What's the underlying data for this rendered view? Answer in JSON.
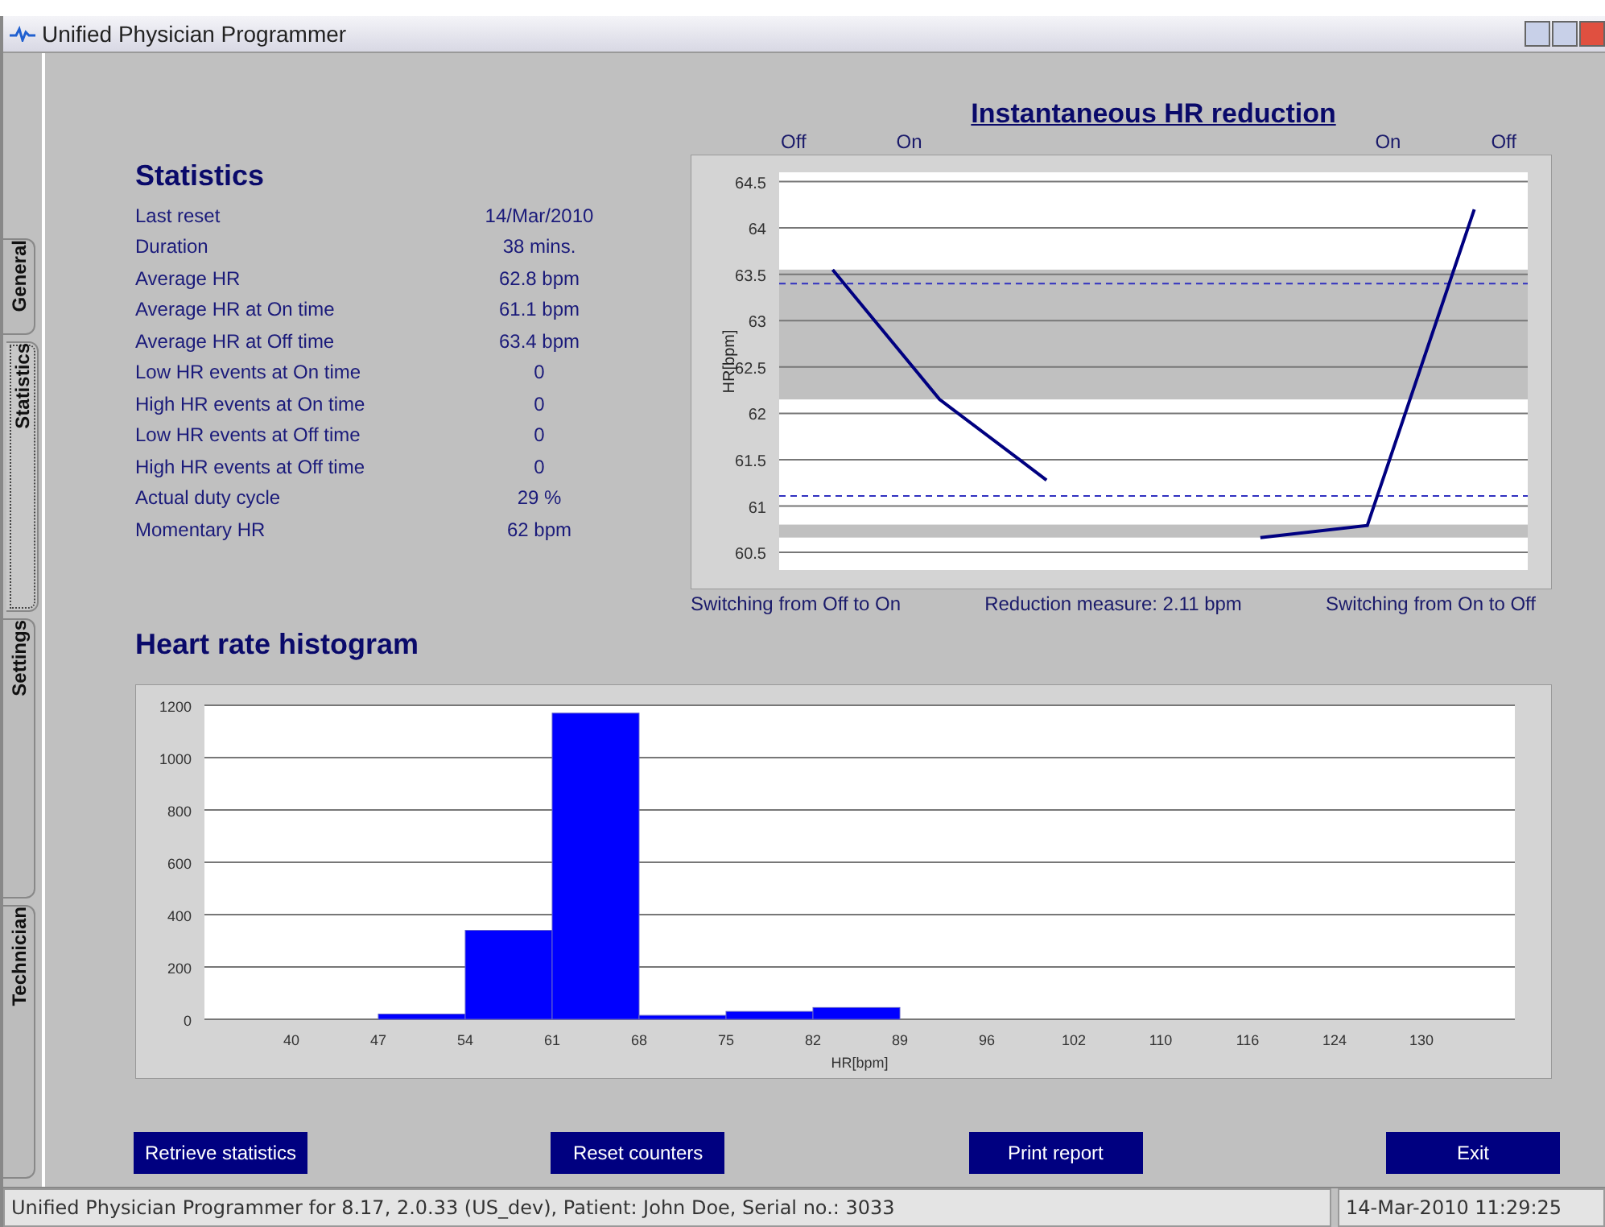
{
  "window": {
    "title": "Unified Physician Programmer"
  },
  "tabs": [
    {
      "label": "General",
      "selected": false
    },
    {
      "label": "Statistics",
      "selected": true
    },
    {
      "label": "Settings",
      "selected": false
    },
    {
      "label": "Technician",
      "selected": false
    }
  ],
  "statistics": {
    "title": "Statistics",
    "rows": [
      {
        "label": "Last reset",
        "value": "14/Mar/2010"
      },
      {
        "label": "Duration",
        "value": "38 mins."
      },
      {
        "label": "Average HR",
        "value": "62.8 bpm"
      },
      {
        "label": "Average HR at On time",
        "value": "61.1 bpm"
      },
      {
        "label": "Average HR at Off time",
        "value": "63.4 bpm"
      },
      {
        "label": "Low HR events at On time",
        "value": "0"
      },
      {
        "label": "High HR events at On time",
        "value": "0"
      },
      {
        "label": "Low HR events at Off time",
        "value": "0"
      },
      {
        "label": "High HR events at Off time",
        "value": "0"
      },
      {
        "label": "Actual duty cycle",
        "value": "29 %"
      },
      {
        "label": "Momentary HR",
        "value": "62 bpm"
      }
    ]
  },
  "reduction_chart": {
    "top_labels": [
      "Off",
      "On",
      "On",
      "Off"
    ],
    "measure": "Reduction measure: 2.11 bpm",
    "chart_data": {
      "type": "line",
      "title": "Instantaneous HR reduction",
      "ylabel": "HR[bpm]",
      "grid": true,
      "ylim": [
        60.31,
        64.6
      ],
      "yticks": [
        60.5,
        61,
        61.5,
        62,
        62.5,
        63,
        63.5,
        64,
        64.5
      ],
      "series": [
        {
          "name": "Switching from Off to On",
          "color": "#000080",
          "values": [
            63.55,
            62.15,
            61.28,
            null,
            null,
            null,
            null
          ]
        },
        {
          "name": "Switching from On to Off",
          "color": "#000080",
          "values": [
            null,
            null,
            null,
            null,
            60.66,
            60.79,
            64.2
          ]
        }
      ],
      "bands": [
        {
          "axis": "y",
          "from": 62.15,
          "to": 63.55
        },
        {
          "axis": "y",
          "from": 60.66,
          "to": 60.8
        }
      ],
      "ref_lines": [
        {
          "axis": "y",
          "value": 63.4
        },
        {
          "axis": "y",
          "value": 61.11
        }
      ]
    }
  },
  "histogram": {
    "chart_data": {
      "type": "bar",
      "title": "Heart rate histogram",
      "xlabel": "HR[bpm]",
      "grid": true,
      "categories": [
        "40",
        "47",
        "54",
        "61",
        "68",
        "75",
        "82",
        "89",
        "96",
        "102",
        "110",
        "116",
        "124",
        "130"
      ],
      "ylim": [
        0,
        1200
      ],
      "yticks": [
        0,
        200,
        400,
        600,
        800,
        1000,
        1200
      ],
      "series": [
        {
          "color": "#0000ff",
          "values": [
            0,
            20,
            340,
            1170,
            15,
            30,
            45,
            0,
            0,
            0,
            0,
            0,
            0,
            0
          ]
        }
      ]
    }
  },
  "buttons": [
    "Retrieve statistics",
    "Reset counters",
    "Print report",
    "Exit"
  ],
  "status_bar": {
    "info": "Unified Physician Programmer for 8.17,  2.0.33  (US_dev),  Patient: John Doe, Serial no.: 3033",
    "datetime": "14-Mar-2010 11:29:25"
  }
}
